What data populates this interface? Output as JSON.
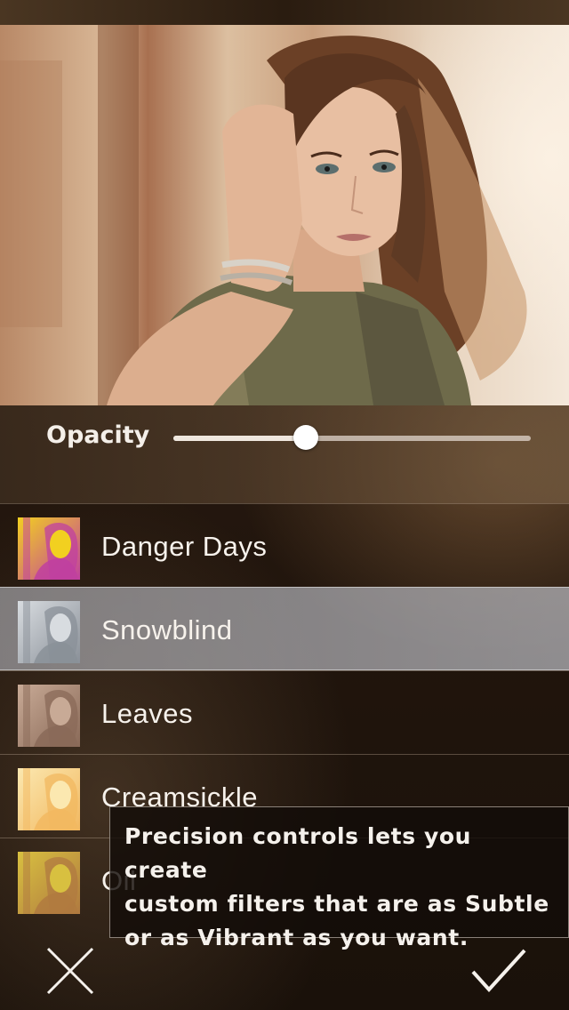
{
  "opacity": {
    "label": "Opacity",
    "value": 0.37
  },
  "filters": [
    {
      "name": "Danger Days",
      "thumb_tint": "#c040a0",
      "thumb_tint2": "#f2d020",
      "selected": false
    },
    {
      "name": "Snowblind",
      "thumb_tint": "#8a9098",
      "thumb_tint2": "#d8dce0",
      "selected": true
    },
    {
      "name": "Leaves",
      "thumb_tint": "#8a6a58",
      "thumb_tint2": "#c8aa96",
      "selected": false
    },
    {
      "name": "Creamsickle",
      "thumb_tint": "#f2b860",
      "thumb_tint2": "#fbe8b0",
      "selected": false
    },
    {
      "name": "Oil",
      "thumb_tint": "#b07a40",
      "thumb_tint2": "#d8c040",
      "selected": false
    }
  ],
  "tooltip": {
    "line1": "Precision controls lets you create",
    "line2": "custom filters that are as Subtle",
    "line3": "or as Vibrant as you want."
  },
  "icons": {
    "cancel": "close-icon",
    "confirm": "checkmark-icon"
  },
  "colors": {
    "selected_row": "#a7a8ad",
    "text": "#f7f2ec"
  }
}
